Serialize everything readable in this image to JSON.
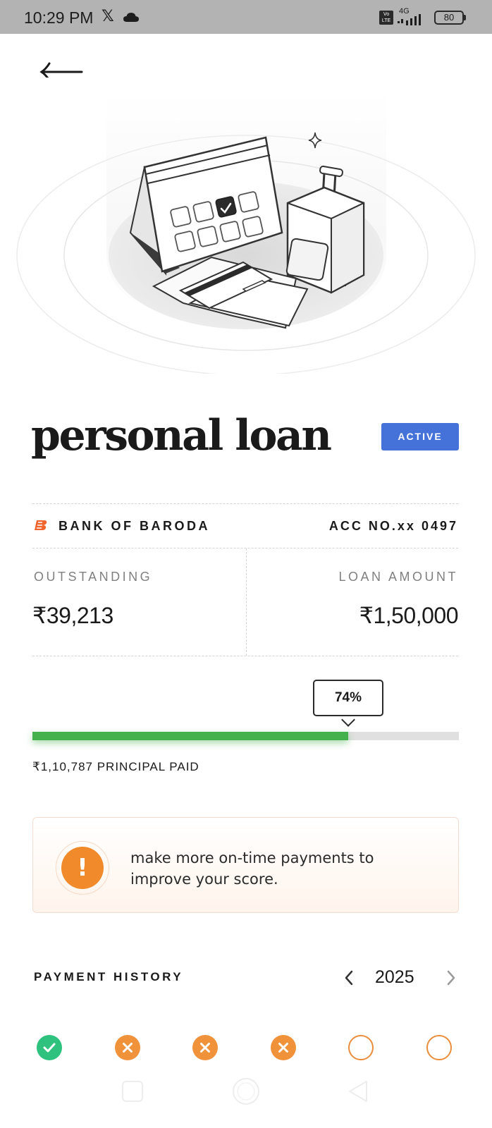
{
  "status_bar": {
    "time": "10:29 PM",
    "x_logo": "𝕏",
    "volte": "Vo LTE",
    "network": "4G",
    "battery": "80"
  },
  "loan": {
    "title": "personal loan",
    "status": "ACTIVE",
    "bank_name": "BANK OF BARODA",
    "account": "ACC NO.xx 0497",
    "outstanding_label": "OUTSTANDING",
    "outstanding_value": "₹39,213",
    "loan_amount_label": "LOAN AMOUNT",
    "loan_amount_value": "₹1,50,000"
  },
  "progress": {
    "percent_label": "74%",
    "fraction_paid": 0.74,
    "principal_paid": "₹1,10,787 PRINCIPAL PAID"
  },
  "tip": {
    "icon": "!",
    "text": "make more on-time payments to improve your score."
  },
  "payment_history": {
    "title": "PAYMENT HISTORY",
    "year": "2025",
    "months": [
      {
        "status": "paid"
      },
      {
        "status": "missed"
      },
      {
        "status": "missed"
      },
      {
        "status": "missed"
      },
      {
        "status": "upcoming"
      },
      {
        "status": "upcoming"
      }
    ]
  },
  "colors": {
    "accent_blue": "#4472d9",
    "progress_green": "#45b14d",
    "paid_green": "#2ec27e",
    "warning_orange": "#f08a2a"
  },
  "icons": {
    "back": "arrow-left-icon",
    "prev_year": "chevron-left-icon",
    "next_year": "chevron-right-icon",
    "tip": "exclamation-icon",
    "paid": "check-icon",
    "missed": "cross-icon"
  }
}
